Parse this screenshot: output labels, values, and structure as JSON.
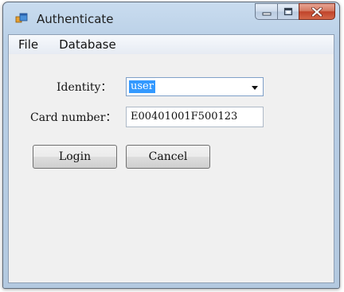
{
  "window": {
    "title": "Authenticate",
    "controls": {
      "minimize": "minimize",
      "maximize": "maximize",
      "close": "close"
    }
  },
  "menu": {
    "items": [
      {
        "label": "File"
      },
      {
        "label": "Database"
      }
    ]
  },
  "form": {
    "identity_label": "Identity：",
    "identity_value": "user",
    "card_label": "Card number：",
    "card_value": "E00401001F500123"
  },
  "buttons": {
    "login": "Login",
    "cancel": "Cancel"
  },
  "colors": {
    "selection": "#3399ff",
    "close_button": "#c0442a",
    "title_bar": "#b9cfe6"
  },
  "icons": [
    "app-icon",
    "minimize-icon",
    "maximize-icon",
    "close-icon",
    "dropdown-arrow-icon"
  ]
}
